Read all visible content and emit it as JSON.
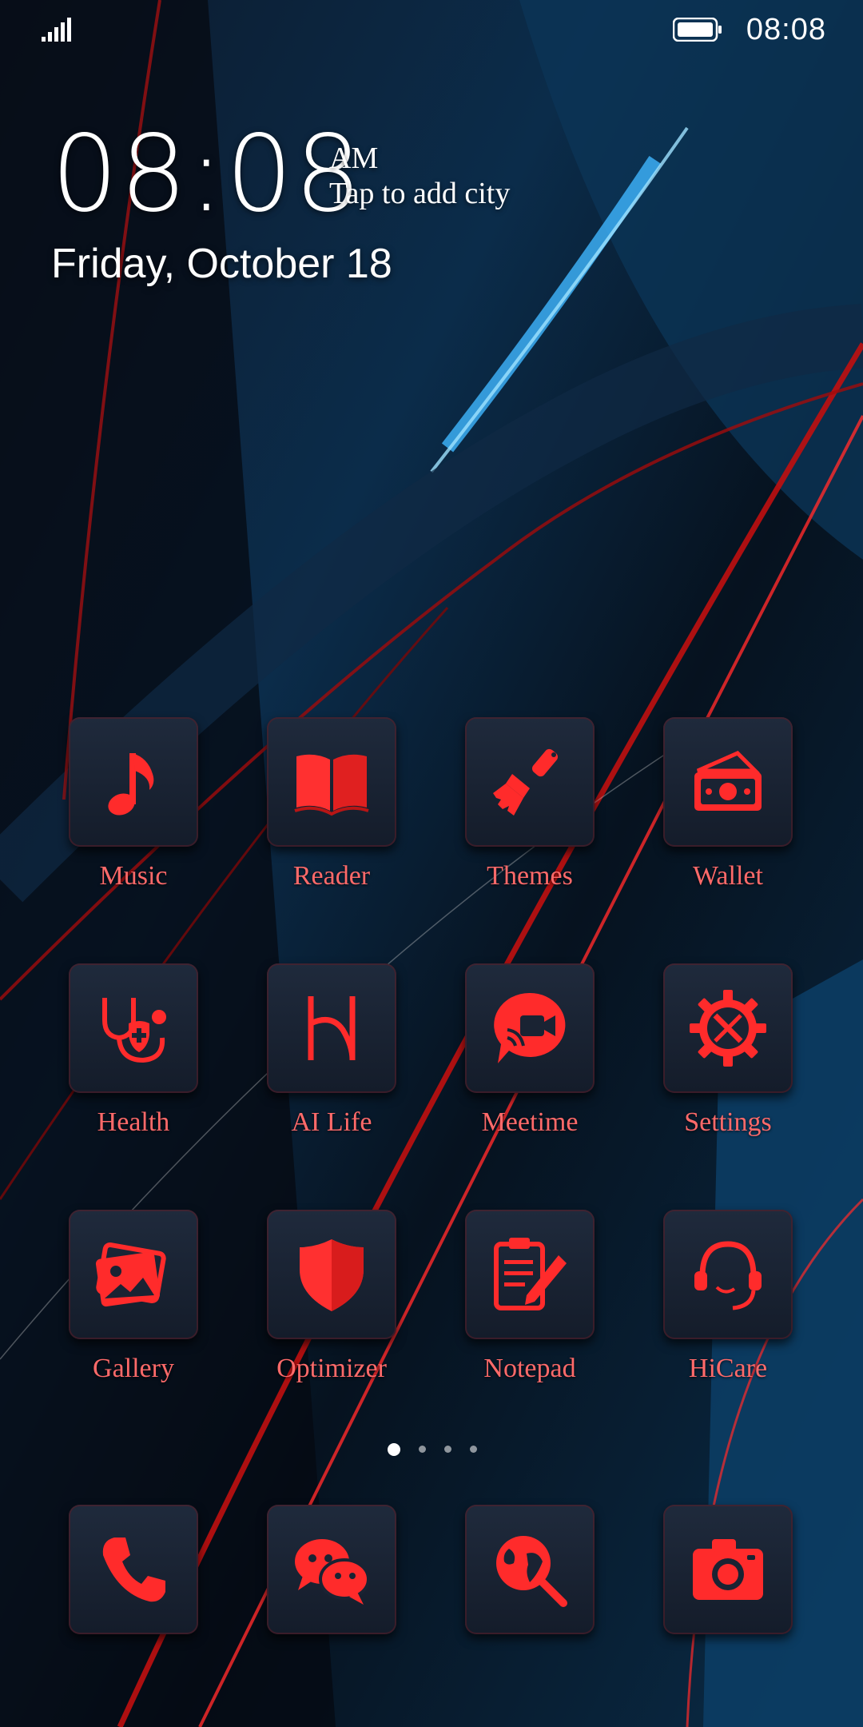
{
  "status_bar": {
    "time": "08:08",
    "signal_icon": "signal-icon",
    "battery_icon": "battery-icon"
  },
  "clock": {
    "time": "08:08",
    "ampm": "AM",
    "city_prompt": "Tap to add city",
    "date": "Friday, October 18"
  },
  "apps": [
    {
      "label": "Music",
      "icon": "music-note-icon"
    },
    {
      "label": "Reader",
      "icon": "book-icon"
    },
    {
      "label": "Themes",
      "icon": "paint-brush-icon"
    },
    {
      "label": "Wallet",
      "icon": "wallet-icon"
    },
    {
      "label": "Health",
      "icon": "stethoscope-icon"
    },
    {
      "label": "AI Life",
      "icon": "ai-life-icon"
    },
    {
      "label": "Meetime",
      "icon": "video-chat-icon"
    },
    {
      "label": "Settings",
      "icon": "gear-tools-icon"
    },
    {
      "label": "Gallery",
      "icon": "photo-icon"
    },
    {
      "label": "Optimizer",
      "icon": "shield-icon"
    },
    {
      "label": "Notepad",
      "icon": "clipboard-pen-icon"
    },
    {
      "label": "HiCare",
      "icon": "headset-icon"
    }
  ],
  "dock": [
    {
      "icon": "phone-icon"
    },
    {
      "icon": "chat-bubbles-icon"
    },
    {
      "icon": "globe-search-icon"
    },
    {
      "icon": "camera-icon"
    }
  ],
  "page_indicator": {
    "pages": 4,
    "current": 1
  },
  "colors": {
    "accent": "#ff2b2b",
    "label": "#ff6a6a",
    "tile": "#1a2333"
  }
}
